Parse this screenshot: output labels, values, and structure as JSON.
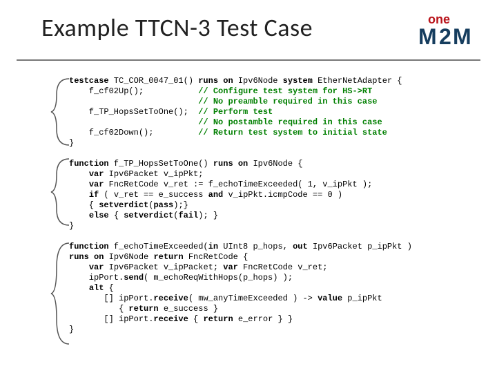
{
  "title": "Example TTCN-3 Test Case",
  "logo": {
    "top": "one",
    "bottom": "M2M",
    "topColor": "#b9131a",
    "bottomColor": "#163d5e"
  },
  "code": {
    "l01a": "testcase",
    "l01b": " TC_COR_0047_01() ",
    "l01c": "runs on",
    "l01d": " Ipv6Node ",
    "l01e": "system",
    "l01f": " EtherNetAdapter {",
    "l02a": "    f_cf02Up();           ",
    "l02b": "// Configure test system for HS->RT",
    "l03a": "                          ",
    "l03b": "// No preamble required in this case",
    "l04a": "    f_TP_HopsSetToOne();  ",
    "l04b": "// Perform test",
    "l05a": "                          ",
    "l05b": "// No postamble required in this case",
    "l06a": "    f_cf02Down();         ",
    "l06b": "// Return test system to initial state",
    "l07": "}",
    "blankA": "",
    "l08a": "function",
    "l08b": " f_TP_HopsSetToOne() ",
    "l08c": "runs on",
    "l08d": " Ipv6Node {",
    "l09a": "    ",
    "l09b": "var",
    "l09c": " Ipv6Packet v_ipPkt;",
    "l10a": "    ",
    "l10b": "var",
    "l10c": " FncRetCode v_ret := f_echoTimeExceeded( 1, v_ipPkt );",
    "l11a": "    ",
    "l11b": "if",
    "l11c": " ( v_ret == e_success ",
    "l11d": "and",
    "l11e": " v_ipPkt.icmpCode == 0 )",
    "l12a": "    { ",
    "l12b": "setverdict",
    "l12c": "(",
    "l12d": "pass",
    "l12e": ");}",
    "l13a": "    ",
    "l13b": "else",
    "l13c": " { ",
    "l13d": "setverdict",
    "l13e": "(",
    "l13f": "fail",
    "l13g": "); }",
    "l14": "}",
    "blankB": "",
    "l15a": "function",
    "l15b": " f_echoTimeExceeded(",
    "l15c": "in",
    "l15d": " UInt8 p_hops, ",
    "l15e": "out",
    "l15f": " Ipv6Packet p_ipPkt )",
    "l16a": "runs on",
    "l16b": " Ipv6Node ",
    "l16c": "return",
    "l16d": " FncRetCode {",
    "l17a": "    ",
    "l17b": "var",
    "l17c": " Ipv6Packet v_ipPacket; ",
    "l17d": "var",
    "l17e": " FncRetCode v_ret;",
    "l18a": "    ipPort.",
    "l18b": "send",
    "l18c": "( m_echoReqWithHops(p_hops) );",
    "l19a": "    ",
    "l19b": "alt",
    "l19c": " {",
    "l20a": "       [] ipPort.",
    "l20b": "receive",
    "l20c": "( mw_anyTimeExceeded ) -> ",
    "l20d": "value",
    "l20e": " p_ipPkt",
    "l21a": "          { ",
    "l21b": "return",
    "l21c": " e_success }",
    "l22a": "       [] ipPort.",
    "l22b": "receive",
    "l22c": " { ",
    "l22d": "return",
    "l22e": " e_error } }",
    "l23": "}"
  }
}
